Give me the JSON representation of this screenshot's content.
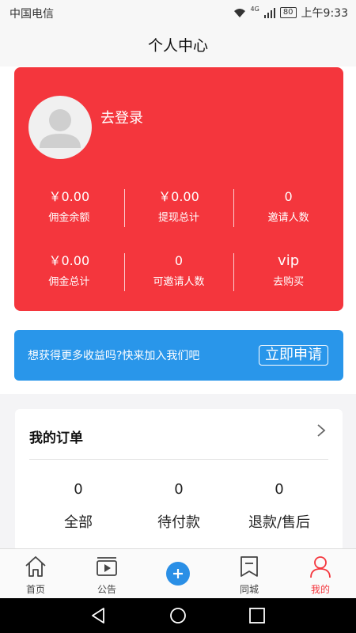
{
  "status_bar": {
    "carrier": "中国电信",
    "network": "4G",
    "battery": "80",
    "time": "上午9:33"
  },
  "header": {
    "title": "个人中心"
  },
  "profile": {
    "login_label": "去登录",
    "stats_row1": [
      {
        "value": "￥0.00",
        "label": "佣金余额"
      },
      {
        "value": "￥0.00",
        "label": "提现总计"
      },
      {
        "value": "0",
        "label": "邀请人数"
      }
    ],
    "stats_row2": [
      {
        "value": "￥0.00",
        "label": "佣金总计"
      },
      {
        "value": "0",
        "label": "可邀请人数"
      },
      {
        "value": "vip",
        "label": "去购买"
      }
    ]
  },
  "promo": {
    "text": "想获得更多收益吗?快来加入我们吧",
    "button_label": "立即申请"
  },
  "orders": {
    "title": "我的订单",
    "items": [
      {
        "count": "0",
        "label": "全部"
      },
      {
        "count": "0",
        "label": "待付款"
      },
      {
        "count": "0",
        "label": "退款/售后"
      }
    ]
  },
  "tab_bar": {
    "items": [
      {
        "label": "首页",
        "icon": "home-icon"
      },
      {
        "label": "公告",
        "icon": "video-icon"
      },
      {
        "label": "",
        "icon": "plus-icon"
      },
      {
        "label": "同城",
        "icon": "bookmark-icon"
      },
      {
        "label": "我的",
        "icon": "person-icon",
        "active": true
      }
    ]
  },
  "colors": {
    "card_red": "#f4363d",
    "promo_blue": "#2996ea",
    "plus_blue": "#2a8fe6"
  }
}
